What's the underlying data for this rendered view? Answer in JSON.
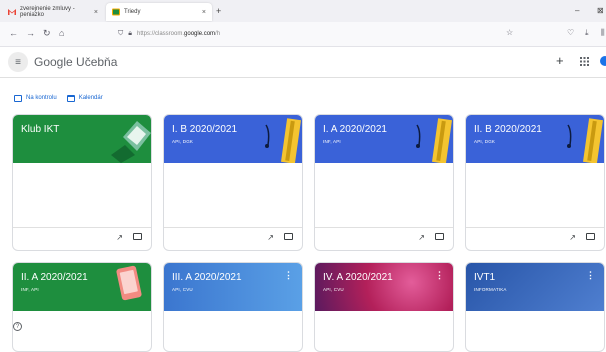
{
  "browser": {
    "tabs": [
      {
        "label": "zverejnenie zmluvy - peniazko",
        "close": "×"
      },
      {
        "label": "Triedy",
        "close": "×"
      }
    ],
    "new_tab": "+",
    "url_prefix": "https://",
    "url_domain_pre": "classroom.",
    "url_domain": "google.com",
    "url_path": "/h",
    "window_controls": {
      "minimize": "–",
      "close": "⊠"
    }
  },
  "app": {
    "logo_text": "Google",
    "product": "Učebňa",
    "add_button": "+",
    "apps_icon": "⋮⋮⋮"
  },
  "links": {
    "to_review": "Na kontrolu",
    "calendar": "Kalendár"
  },
  "cards": [
    {
      "title": "Klub IKT",
      "subtitle": "",
      "color": "#1e8e3e"
    },
    {
      "title": "I. B 2020/2021",
      "subtitle": "API, DGK",
      "color": "#3a62d8"
    },
    {
      "title": "I. A 2020/2021",
      "subtitle": "INF, API",
      "color": "#3a62d8"
    },
    {
      "title": "II. B 2020/2021",
      "subtitle": "API, DGK",
      "color": "#3a62d8"
    },
    {
      "title": "II. A 2020/2021",
      "subtitle": "INF, API",
      "color": "#1e8e3e"
    },
    {
      "title": "III. A 2020/2021",
      "subtitle": "API, CVU",
      "color": "#3b76cf"
    },
    {
      "title": "IV. A 2020/2021",
      "subtitle": "API, CVU",
      "color": "#b3205a"
    },
    {
      "title": "IVT1",
      "subtitle": "INFORMATIKA",
      "color": "#2855a8"
    }
  ],
  "icons": {
    "trend": "↗",
    "more": "⋮",
    "help": "?"
  }
}
